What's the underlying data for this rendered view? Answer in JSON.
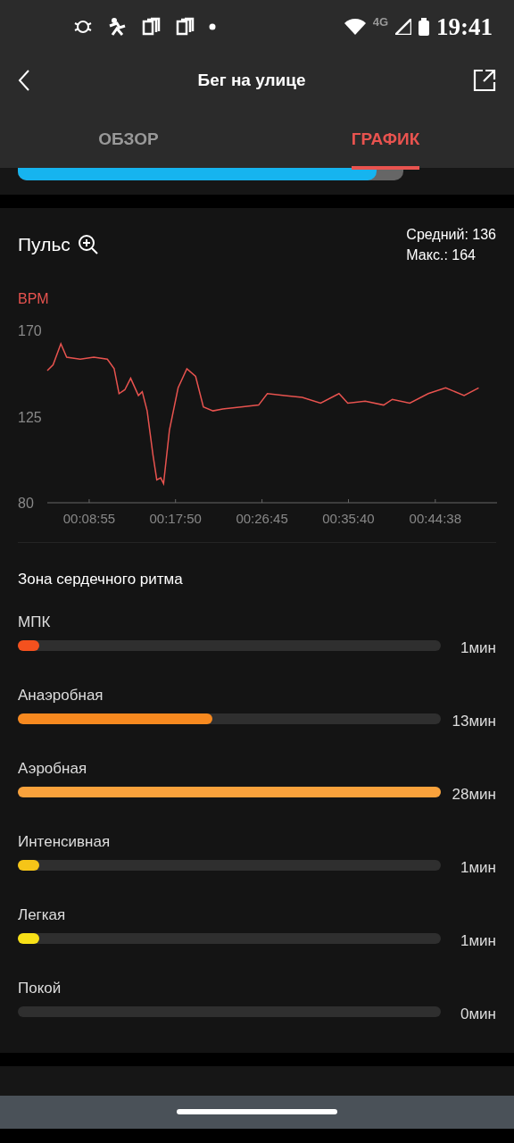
{
  "status_bar": {
    "network": "4G",
    "time": "19:41"
  },
  "header": {
    "title": "Бег на улице"
  },
  "tabs": [
    {
      "label": "ОБЗОР",
      "selected": false
    },
    {
      "label": "ГРАФИК",
      "selected": true
    }
  ],
  "pace_strip": {
    "level": 0.93
  },
  "pulse": {
    "title": "Пульс",
    "average": "Средний: 136",
    "max": "Макс.: 164",
    "chart_data": {
      "type": "line",
      "ylabel": "BPM",
      "xlim": [
        4.6,
        51.0
      ],
      "ylim": [
        80,
        170
      ],
      "yticks": [
        80,
        125,
        170
      ],
      "xticks": [
        {
          "value": 8.92,
          "label": "00:08:55"
        },
        {
          "value": 17.83,
          "label": "00:17:50"
        },
        {
          "value": 26.75,
          "label": "00:26:45"
        },
        {
          "value": 35.67,
          "label": "00:35:40"
        },
        {
          "value": 44.63,
          "label": "00:44:38"
        }
      ],
      "x": [
        4.6,
        5.2,
        6.0,
        6.6,
        8.0,
        9.4,
        10.8,
        11.5,
        12.0,
        12.6,
        13.2,
        14.0,
        14.4,
        14.9,
        15.5,
        15.9,
        16.3,
        16.6,
        17.2,
        18.1,
        19.0,
        19.9,
        20.7,
        21.7,
        22.7,
        24.6,
        26.4,
        27.3,
        29.1,
        30.9,
        32.8,
        34.7,
        35.6,
        37.4,
        39.3,
        40.2,
        42.0,
        43.9,
        45.7,
        47.6,
        49.1
      ],
      "series": [
        {
          "color": "#e8534f",
          "values": [
            149,
            152,
            163,
            156,
            155,
            156,
            155,
            150,
            137,
            139,
            145,
            136,
            138,
            128,
            105,
            92,
            93,
            90,
            118,
            140,
            150,
            146,
            130,
            128,
            129,
            130,
            131,
            137,
            136,
            135,
            132,
            137,
            132,
            133,
            131,
            134,
            132,
            137,
            140,
            136,
            140
          ]
        }
      ]
    }
  },
  "zones": {
    "title": "Зона сердечного ритма",
    "items": [
      {
        "name": "МПК",
        "level": 0.05,
        "duration": "1мин",
        "color": "#f4511e"
      },
      {
        "name": "Анаэробная",
        "level": 0.46,
        "duration": "13мин",
        "color": "#f7891f"
      },
      {
        "name": "Аэробная",
        "level": 1.0,
        "duration": "28мин",
        "color": "#f9a23c"
      },
      {
        "name": "Интенсивная",
        "level": 0.05,
        "duration": "1мин",
        "color": "#f5c518"
      },
      {
        "name": "Легкая",
        "level": 0.05,
        "duration": "1мин",
        "color": "#f7e017"
      },
      {
        "name": "Покой",
        "duration": "0мин"
      }
    ]
  }
}
